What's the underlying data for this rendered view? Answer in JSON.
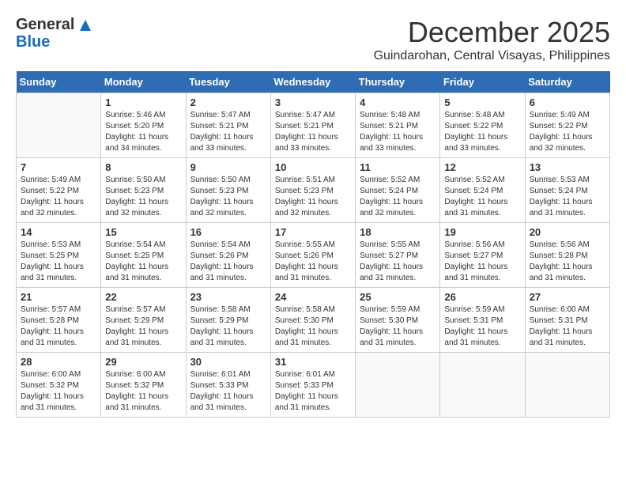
{
  "logo": {
    "general": "General",
    "blue": "Blue"
  },
  "title": {
    "month_year": "December 2025",
    "location": "Guindarohan, Central Visayas, Philippines"
  },
  "days_of_week": [
    "Sunday",
    "Monday",
    "Tuesday",
    "Wednesday",
    "Thursday",
    "Friday",
    "Saturday"
  ],
  "weeks": [
    [
      {
        "day": "",
        "info": ""
      },
      {
        "day": "1",
        "info": "Sunrise: 5:46 AM\nSunset: 5:20 PM\nDaylight: 11 hours\nand 34 minutes."
      },
      {
        "day": "2",
        "info": "Sunrise: 5:47 AM\nSunset: 5:21 PM\nDaylight: 11 hours\nand 33 minutes."
      },
      {
        "day": "3",
        "info": "Sunrise: 5:47 AM\nSunset: 5:21 PM\nDaylight: 11 hours\nand 33 minutes."
      },
      {
        "day": "4",
        "info": "Sunrise: 5:48 AM\nSunset: 5:21 PM\nDaylight: 11 hours\nand 33 minutes."
      },
      {
        "day": "5",
        "info": "Sunrise: 5:48 AM\nSunset: 5:22 PM\nDaylight: 11 hours\nand 33 minutes."
      },
      {
        "day": "6",
        "info": "Sunrise: 5:49 AM\nSunset: 5:22 PM\nDaylight: 11 hours\nand 32 minutes."
      }
    ],
    [
      {
        "day": "7",
        "info": "Sunrise: 5:49 AM\nSunset: 5:22 PM\nDaylight: 11 hours\nand 32 minutes."
      },
      {
        "day": "8",
        "info": "Sunrise: 5:50 AM\nSunset: 5:23 PM\nDaylight: 11 hours\nand 32 minutes."
      },
      {
        "day": "9",
        "info": "Sunrise: 5:50 AM\nSunset: 5:23 PM\nDaylight: 11 hours\nand 32 minutes."
      },
      {
        "day": "10",
        "info": "Sunrise: 5:51 AM\nSunset: 5:23 PM\nDaylight: 11 hours\nand 32 minutes."
      },
      {
        "day": "11",
        "info": "Sunrise: 5:52 AM\nSunset: 5:24 PM\nDaylight: 11 hours\nand 32 minutes."
      },
      {
        "day": "12",
        "info": "Sunrise: 5:52 AM\nSunset: 5:24 PM\nDaylight: 11 hours\nand 31 minutes."
      },
      {
        "day": "13",
        "info": "Sunrise: 5:53 AM\nSunset: 5:24 PM\nDaylight: 11 hours\nand 31 minutes."
      }
    ],
    [
      {
        "day": "14",
        "info": "Sunrise: 5:53 AM\nSunset: 5:25 PM\nDaylight: 11 hours\nand 31 minutes."
      },
      {
        "day": "15",
        "info": "Sunrise: 5:54 AM\nSunset: 5:25 PM\nDaylight: 11 hours\nand 31 minutes."
      },
      {
        "day": "16",
        "info": "Sunrise: 5:54 AM\nSunset: 5:26 PM\nDaylight: 11 hours\nand 31 minutes."
      },
      {
        "day": "17",
        "info": "Sunrise: 5:55 AM\nSunset: 5:26 PM\nDaylight: 11 hours\nand 31 minutes."
      },
      {
        "day": "18",
        "info": "Sunrise: 5:55 AM\nSunset: 5:27 PM\nDaylight: 11 hours\nand 31 minutes."
      },
      {
        "day": "19",
        "info": "Sunrise: 5:56 AM\nSunset: 5:27 PM\nDaylight: 11 hours\nand 31 minutes."
      },
      {
        "day": "20",
        "info": "Sunrise: 5:56 AM\nSunset: 5:28 PM\nDaylight: 11 hours\nand 31 minutes."
      }
    ],
    [
      {
        "day": "21",
        "info": "Sunrise: 5:57 AM\nSunset: 5:28 PM\nDaylight: 11 hours\nand 31 minutes."
      },
      {
        "day": "22",
        "info": "Sunrise: 5:57 AM\nSunset: 5:29 PM\nDaylight: 11 hours\nand 31 minutes."
      },
      {
        "day": "23",
        "info": "Sunrise: 5:58 AM\nSunset: 5:29 PM\nDaylight: 11 hours\nand 31 minutes."
      },
      {
        "day": "24",
        "info": "Sunrise: 5:58 AM\nSunset: 5:30 PM\nDaylight: 11 hours\nand 31 minutes."
      },
      {
        "day": "25",
        "info": "Sunrise: 5:59 AM\nSunset: 5:30 PM\nDaylight: 11 hours\nand 31 minutes."
      },
      {
        "day": "26",
        "info": "Sunrise: 5:59 AM\nSunset: 5:31 PM\nDaylight: 11 hours\nand 31 minutes."
      },
      {
        "day": "27",
        "info": "Sunrise: 6:00 AM\nSunset: 5:31 PM\nDaylight: 11 hours\nand 31 minutes."
      }
    ],
    [
      {
        "day": "28",
        "info": "Sunrise: 6:00 AM\nSunset: 5:32 PM\nDaylight: 11 hours\nand 31 minutes."
      },
      {
        "day": "29",
        "info": "Sunrise: 6:00 AM\nSunset: 5:32 PM\nDaylight: 11 hours\nand 31 minutes."
      },
      {
        "day": "30",
        "info": "Sunrise: 6:01 AM\nSunset: 5:33 PM\nDaylight: 11 hours\nand 31 minutes."
      },
      {
        "day": "31",
        "info": "Sunrise: 6:01 AM\nSunset: 5:33 PM\nDaylight: 11 hours\nand 31 minutes."
      },
      {
        "day": "",
        "info": ""
      },
      {
        "day": "",
        "info": ""
      },
      {
        "day": "",
        "info": ""
      }
    ]
  ]
}
